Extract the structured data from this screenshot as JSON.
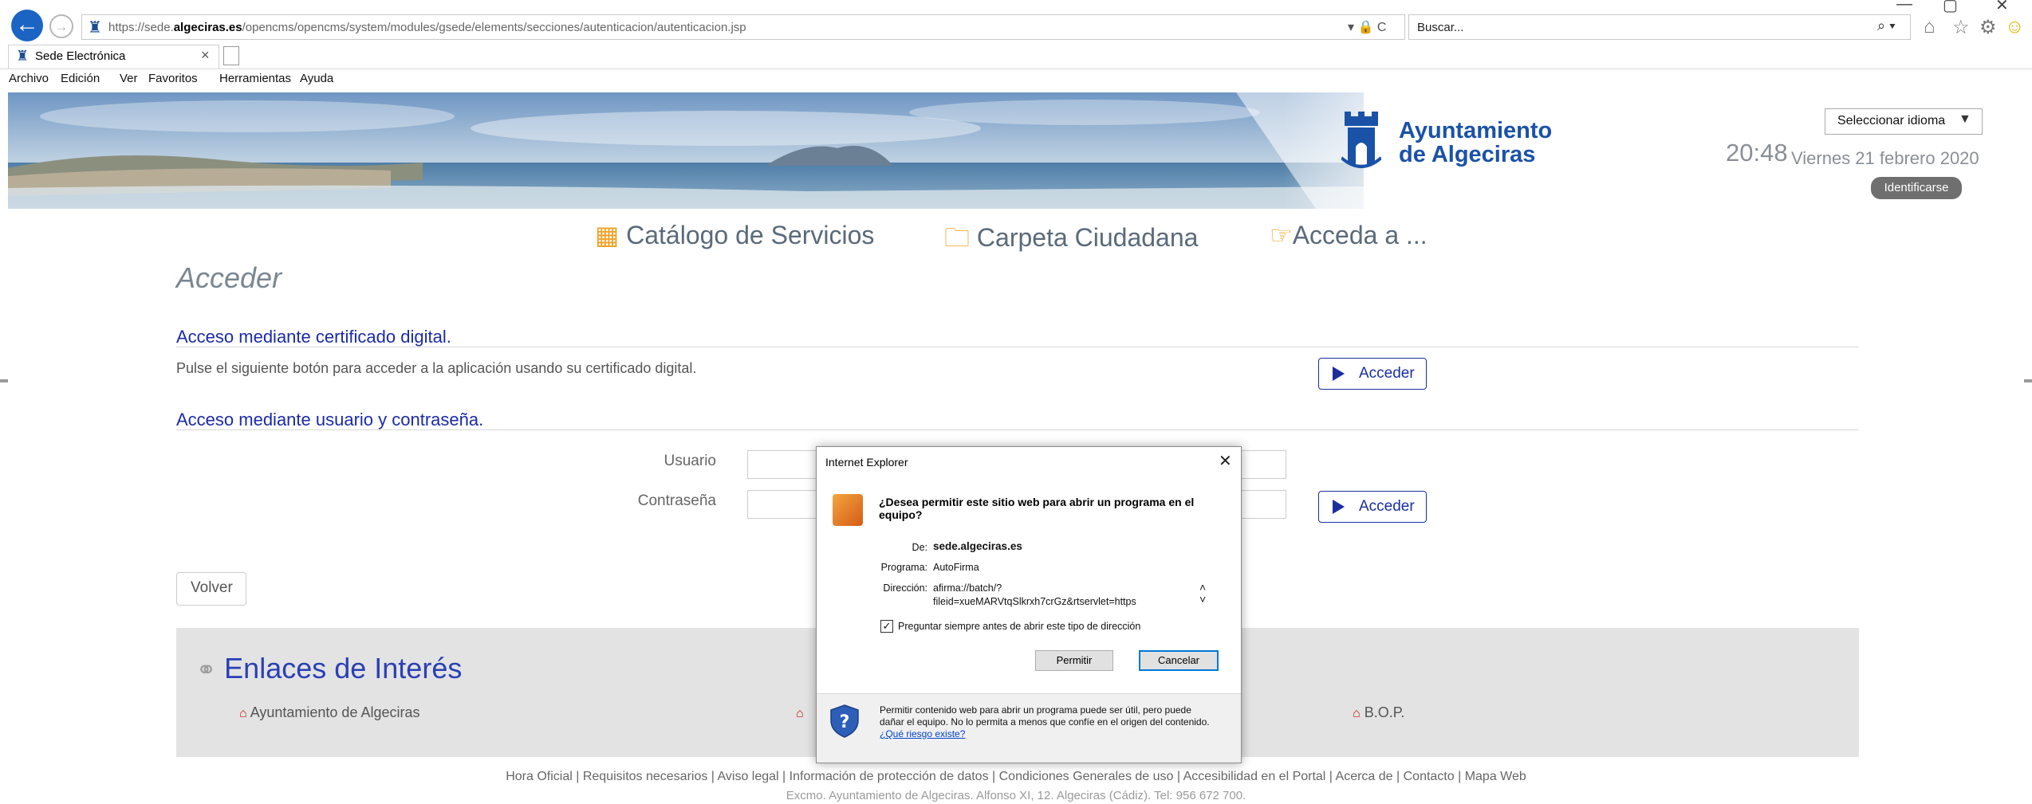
{
  "browser": {
    "url_prefix": "https://sede.",
    "url_domain": "algeciras.es",
    "url_path": "/opencms/opencms/system/modules/gsede/elements/secciones/autenticacion/autenticacion.jsp",
    "addr_tools": "▾ 🔒 C",
    "search_placeholder": "Buscar...",
    "search_tools": "⌕ ▾",
    "tab_label": "Sede Electrónica",
    "tab_close": "×",
    "window_controls": [
      "—",
      "▢",
      "✕"
    ],
    "menu": [
      "Archivo",
      "Edición",
      "Ver",
      "Favoritos",
      "Herramientas",
      "Ayuda"
    ]
  },
  "header": {
    "logo_line1": "Ayuntamiento",
    "logo_line2": "de Algeciras",
    "language_select": "Seleccionar idioma",
    "language_arrow": "▼",
    "time": "20:48",
    "date": "Viernes 21 febrero 2020",
    "identify_button": "Identificarse"
  },
  "nav": [
    {
      "label": "Catálogo de Servicios",
      "icon": "grid-icon"
    },
    {
      "label": "Carpeta Ciudadana",
      "icon": "folder-icon"
    },
    {
      "label": "Acceda a ...",
      "icon": "hand-pointer-icon"
    }
  ],
  "main": {
    "title": "Acceder",
    "cert_section_title": "Acceso mediante certificado digital.",
    "cert_help": "Pulse el siguiente botón para acceder a la aplicación usando su certificado digital.",
    "access_button": "Acceder",
    "user_section_title": "Acceso mediante usuario y contraseña.",
    "user_label": "Usuario",
    "password_label": "Contraseña",
    "user_value": "",
    "password_value": "",
    "back_button": "Volver"
  },
  "links": {
    "title": "Enlaces de Interés",
    "items": [
      "Ayuntamiento de Algeciras",
      "B.O.P."
    ]
  },
  "footer": {
    "links": "Hora Oficial | Requisitos necesarios | Aviso legal | Información de protección de datos | Condiciones Generales de uso | Accesibilidad en el Portal | Acerca de | Contacto | Mapa Web",
    "address": "Excmo. Ayuntamiento de Algeciras. Alfonso XI, 12. Algeciras (Cádiz). Tel: 956 672 700."
  },
  "dialog": {
    "title": "Internet Explorer",
    "close": "✕",
    "question": "¿Desea permitir este sitio web para abrir un programa en el equipo?",
    "from_label": "De:",
    "from_value": "sede.algeciras.es",
    "program_label": "Programa:",
    "program_value": "AutoFirma",
    "address_label": "Dirección:",
    "address_line1": "afirma://batch/?",
    "address_line2": "fileid=xueMARVtqSlkrxh7crGz&rtservlet=https",
    "checkbox_label": "Preguntar siempre antes de abrir este tipo de dirección",
    "checkbox_checked": true,
    "allow_button": "Permitir",
    "cancel_button": "Cancelar",
    "warning_text": "Permitir contenido web para abrir un programa puede ser útil, pero puede dañar el equipo. No lo permita a menos que confíe en el origen del contenido.",
    "warning_link": "¿Qué riesgo existe?"
  },
  "colors": {
    "accent_blue": "#1b2ba8",
    "logo_blue": "#1a52a8",
    "nav_icon_orange": "#f0a020",
    "home_icon_red": "#c81414",
    "dialog_focus": "#0078d7"
  }
}
